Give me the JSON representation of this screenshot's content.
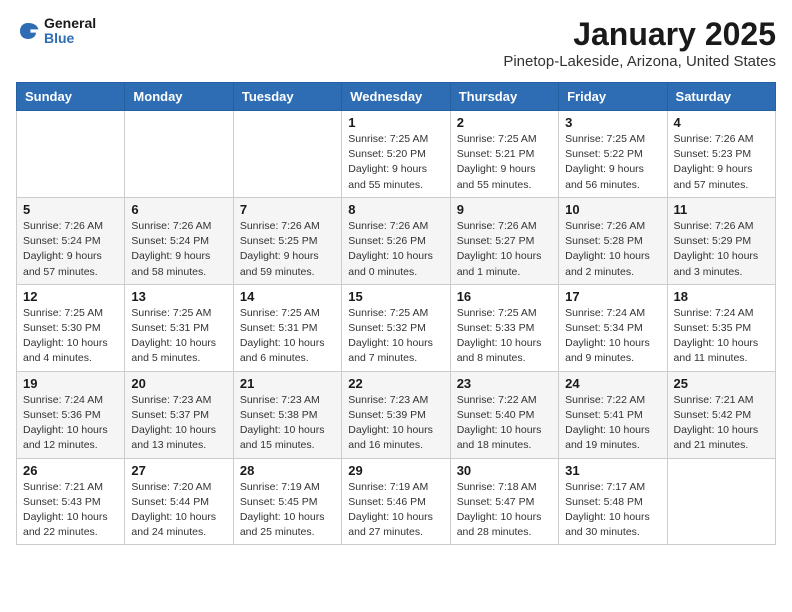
{
  "header": {
    "logo_general": "General",
    "logo_blue": "Blue",
    "month_title": "January 2025",
    "location": "Pinetop-Lakeside, Arizona, United States"
  },
  "weekdays": [
    "Sunday",
    "Monday",
    "Tuesday",
    "Wednesday",
    "Thursday",
    "Friday",
    "Saturday"
  ],
  "weeks": [
    [
      {
        "day": "",
        "info": ""
      },
      {
        "day": "",
        "info": ""
      },
      {
        "day": "",
        "info": ""
      },
      {
        "day": "1",
        "info": "Sunrise: 7:25 AM\nSunset: 5:20 PM\nDaylight: 9 hours\nand 55 minutes."
      },
      {
        "day": "2",
        "info": "Sunrise: 7:25 AM\nSunset: 5:21 PM\nDaylight: 9 hours\nand 55 minutes."
      },
      {
        "day": "3",
        "info": "Sunrise: 7:25 AM\nSunset: 5:22 PM\nDaylight: 9 hours\nand 56 minutes."
      },
      {
        "day": "4",
        "info": "Sunrise: 7:26 AM\nSunset: 5:23 PM\nDaylight: 9 hours\nand 57 minutes."
      }
    ],
    [
      {
        "day": "5",
        "info": "Sunrise: 7:26 AM\nSunset: 5:24 PM\nDaylight: 9 hours\nand 57 minutes."
      },
      {
        "day": "6",
        "info": "Sunrise: 7:26 AM\nSunset: 5:24 PM\nDaylight: 9 hours\nand 58 minutes."
      },
      {
        "day": "7",
        "info": "Sunrise: 7:26 AM\nSunset: 5:25 PM\nDaylight: 9 hours\nand 59 minutes."
      },
      {
        "day": "8",
        "info": "Sunrise: 7:26 AM\nSunset: 5:26 PM\nDaylight: 10 hours\nand 0 minutes."
      },
      {
        "day": "9",
        "info": "Sunrise: 7:26 AM\nSunset: 5:27 PM\nDaylight: 10 hours\nand 1 minute."
      },
      {
        "day": "10",
        "info": "Sunrise: 7:26 AM\nSunset: 5:28 PM\nDaylight: 10 hours\nand 2 minutes."
      },
      {
        "day": "11",
        "info": "Sunrise: 7:26 AM\nSunset: 5:29 PM\nDaylight: 10 hours\nand 3 minutes."
      }
    ],
    [
      {
        "day": "12",
        "info": "Sunrise: 7:25 AM\nSunset: 5:30 PM\nDaylight: 10 hours\nand 4 minutes."
      },
      {
        "day": "13",
        "info": "Sunrise: 7:25 AM\nSunset: 5:31 PM\nDaylight: 10 hours\nand 5 minutes."
      },
      {
        "day": "14",
        "info": "Sunrise: 7:25 AM\nSunset: 5:31 PM\nDaylight: 10 hours\nand 6 minutes."
      },
      {
        "day": "15",
        "info": "Sunrise: 7:25 AM\nSunset: 5:32 PM\nDaylight: 10 hours\nand 7 minutes."
      },
      {
        "day": "16",
        "info": "Sunrise: 7:25 AM\nSunset: 5:33 PM\nDaylight: 10 hours\nand 8 minutes."
      },
      {
        "day": "17",
        "info": "Sunrise: 7:24 AM\nSunset: 5:34 PM\nDaylight: 10 hours\nand 9 minutes."
      },
      {
        "day": "18",
        "info": "Sunrise: 7:24 AM\nSunset: 5:35 PM\nDaylight: 10 hours\nand 11 minutes."
      }
    ],
    [
      {
        "day": "19",
        "info": "Sunrise: 7:24 AM\nSunset: 5:36 PM\nDaylight: 10 hours\nand 12 minutes."
      },
      {
        "day": "20",
        "info": "Sunrise: 7:23 AM\nSunset: 5:37 PM\nDaylight: 10 hours\nand 13 minutes."
      },
      {
        "day": "21",
        "info": "Sunrise: 7:23 AM\nSunset: 5:38 PM\nDaylight: 10 hours\nand 15 minutes."
      },
      {
        "day": "22",
        "info": "Sunrise: 7:23 AM\nSunset: 5:39 PM\nDaylight: 10 hours\nand 16 minutes."
      },
      {
        "day": "23",
        "info": "Sunrise: 7:22 AM\nSunset: 5:40 PM\nDaylight: 10 hours\nand 18 minutes."
      },
      {
        "day": "24",
        "info": "Sunrise: 7:22 AM\nSunset: 5:41 PM\nDaylight: 10 hours\nand 19 minutes."
      },
      {
        "day": "25",
        "info": "Sunrise: 7:21 AM\nSunset: 5:42 PM\nDaylight: 10 hours\nand 21 minutes."
      }
    ],
    [
      {
        "day": "26",
        "info": "Sunrise: 7:21 AM\nSunset: 5:43 PM\nDaylight: 10 hours\nand 22 minutes."
      },
      {
        "day": "27",
        "info": "Sunrise: 7:20 AM\nSunset: 5:44 PM\nDaylight: 10 hours\nand 24 minutes."
      },
      {
        "day": "28",
        "info": "Sunrise: 7:19 AM\nSunset: 5:45 PM\nDaylight: 10 hours\nand 25 minutes."
      },
      {
        "day": "29",
        "info": "Sunrise: 7:19 AM\nSunset: 5:46 PM\nDaylight: 10 hours\nand 27 minutes."
      },
      {
        "day": "30",
        "info": "Sunrise: 7:18 AM\nSunset: 5:47 PM\nDaylight: 10 hours\nand 28 minutes."
      },
      {
        "day": "31",
        "info": "Sunrise: 7:17 AM\nSunset: 5:48 PM\nDaylight: 10 hours\nand 30 minutes."
      },
      {
        "day": "",
        "info": ""
      }
    ]
  ]
}
